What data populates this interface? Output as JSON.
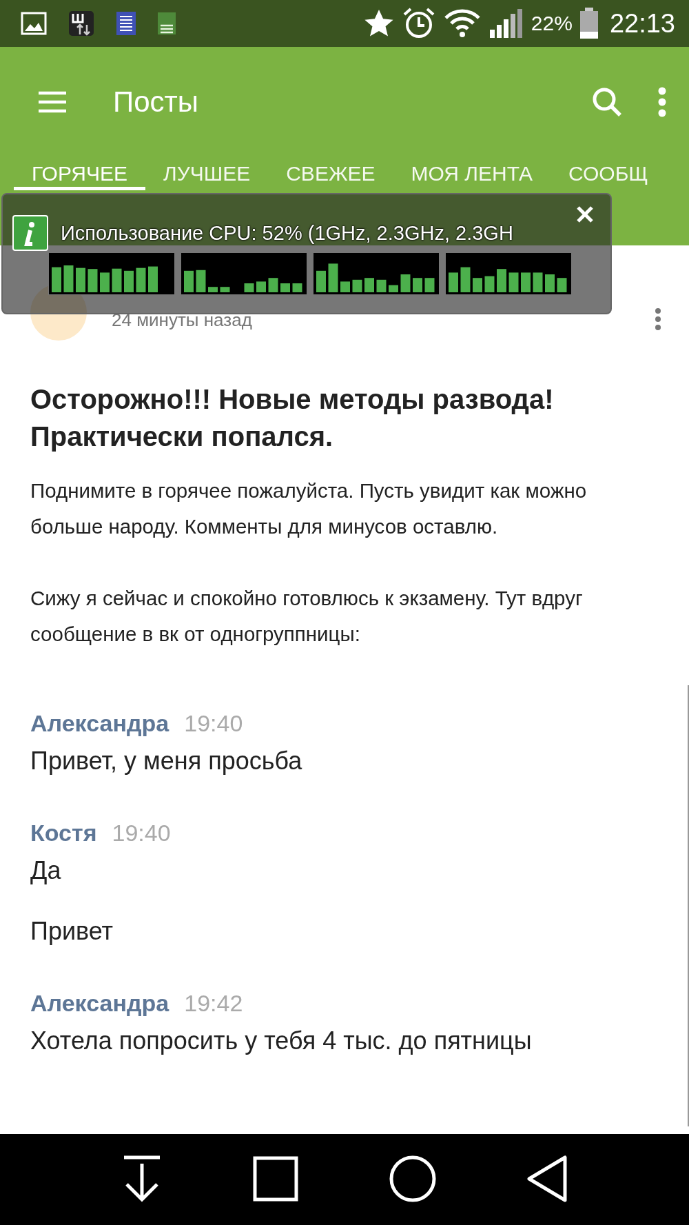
{
  "status_bar": {
    "battery": "22%",
    "time": "22:13"
  },
  "app_bar": {
    "title": "Посты"
  },
  "tabs": [
    {
      "label": "ГОРЯЧЕЕ",
      "selected": true
    },
    {
      "label": "ЛУЧШЕЕ",
      "selected": false
    },
    {
      "label": "СВЕЖЕЕ",
      "selected": false
    },
    {
      "label": "МОЯ ЛЕНТА",
      "selected": false
    },
    {
      "label": "СООБЩ",
      "selected": false
    }
  ],
  "cpu_overlay": {
    "title": "Использование CPU: 52% (1GHz, 2.3GHz, 2.3GH"
  },
  "post": {
    "time": "24 минуты назад",
    "title": "Осторожно!!! Новые методы развода! Практически попался.",
    "paragraphs": [
      "Поднимите в горячее пожалуйста. Пусть увидит как можно больше народу. Комменты для минусов оставлю.",
      "Сижу я сейчас и спокойно готовлюсь к экзамену. Тут вдруг сообщение в вк от одногруппницы:"
    ],
    "chat": [
      {
        "author": "Александра",
        "time": "19:40",
        "messages": [
          "Привет, у меня просьба"
        ]
      },
      {
        "author": "Костя",
        "time": "19:40",
        "messages": [
          "Да",
          "Привет"
        ]
      },
      {
        "author": "Александра",
        "time": "19:42",
        "messages": [
          "Хотела попросить у тебя 4 тыс. до пятницы"
        ]
      }
    ]
  }
}
